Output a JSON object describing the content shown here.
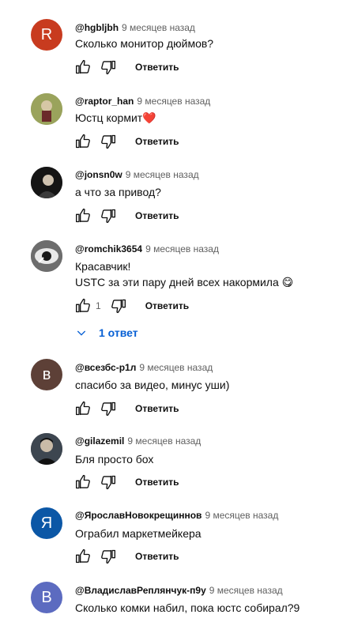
{
  "comments": [
    {
      "author": "@hgbljbh",
      "time": "9 месяцев назад",
      "lines": [
        "Сколько монитор дюймов?"
      ],
      "avatar_letter": "R",
      "avatar_color": "#c83b1f",
      "reply_label": "Ответить",
      "likes": ""
    },
    {
      "author": "@raptor_han",
      "time": "9 месяцев назад",
      "lines": [
        "Юстц кормит"
      ],
      "avatar_letter": "",
      "avatar_color": "#7d8a4a",
      "reply_label": "Ответить",
      "likes": ""
    },
    {
      "author": "@jonsn0w",
      "time": "9 месяцев назад",
      "lines": [
        "а что за привод?"
      ],
      "avatar_letter": "",
      "avatar_color": "#1e1e1e",
      "reply_label": "Ответить",
      "likes": ""
    },
    {
      "author": "@romchik3654",
      "time": "9 месяцев назад",
      "lines": [
        "Красавчик!",
        "USTC за эти пару дней всех накормила"
      ],
      "avatar_letter": "",
      "avatar_color": "#555555",
      "reply_label": "Ответить",
      "likes": "1"
    },
    {
      "author": "@всезбс-р1л",
      "time": "9 месяцев назад",
      "lines": [
        "спасибо за видео, минус уши)"
      ],
      "avatar_letter": "в",
      "avatar_color": "#5d4037",
      "reply_label": "Ответить",
      "likes": ""
    },
    {
      "author": "@gilazemil",
      "time": "9 месяцев назад",
      "lines": [
        "Бля просто бох"
      ],
      "avatar_letter": "",
      "avatar_color": "#2a2e33",
      "reply_label": "Ответить",
      "likes": ""
    },
    {
      "author": "@ЯрославНовокрещиннов",
      "time": "9 месяцев назад",
      "lines": [
        "Ограбил маркетмейкера"
      ],
      "avatar_letter": "Я",
      "avatar_color": "#0b57a6",
      "reply_label": "Ответить",
      "likes": ""
    },
    {
      "author": "@ВладиславРеплянчук-п9у",
      "time": "9 месяцев назад",
      "lines": [
        "Сколько комки набил, пока юстс собирал?9"
      ],
      "avatar_letter": "В",
      "avatar_color": "#5c6bc0",
      "reply_label": "",
      "likes": ""
    }
  ],
  "replies_toggle": "1 ответ",
  "emoji": {
    "heart": "❤️",
    "yum": "😋"
  }
}
